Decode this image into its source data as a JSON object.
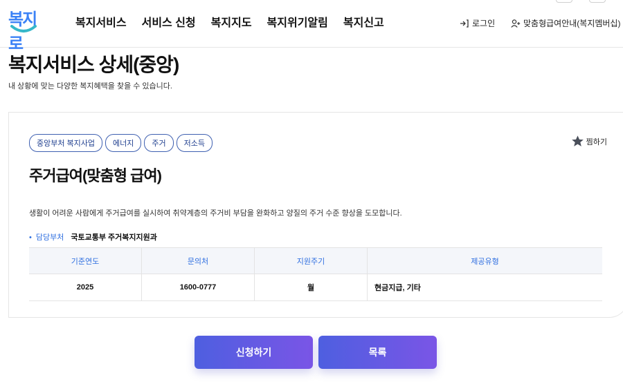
{
  "header": {
    "logo_text": "복지로",
    "nav": [
      "복지서비스",
      "서비스 신청",
      "복지지도",
      "복지위기알림",
      "복지신고"
    ],
    "login_label": "로그인",
    "guide_label": "맞춤형급여안내(복지멤버십)"
  },
  "page": {
    "title": "복지서비스 상세(중앙)",
    "subtitle": "내 상황에 맞는 다양한 복지혜택을 찾을 수 있습니다."
  },
  "service": {
    "tags": [
      "중앙부처 복지사업",
      "에너지",
      "주거",
      "저소득"
    ],
    "favorite_label": "찜하기",
    "title": "주거급여(맞춤형 급여)",
    "description": "생활이 어려운 사람에게 주거급여를 실시하여 취약계층의 주거비 부담을 완화하고 양질의 주거 수준 향상을 도모합니다.",
    "dept_label": "담당부처",
    "dept_value": "국토교통부 주거복지지원과",
    "table": {
      "headers": [
        "기준연도",
        "문의처",
        "지원주기",
        "제공유형"
      ],
      "row": [
        "2025",
        "1600-0777",
        "월",
        "현금지급, 기타"
      ]
    }
  },
  "buttons": {
    "apply": "신청하기",
    "list": "목록"
  },
  "colors": {
    "accent": "#2f6fe0",
    "button_gradient_start": "#4e5fe0",
    "button_gradient_end": "#7a55e6",
    "tag_border": "#3d5fb0"
  }
}
